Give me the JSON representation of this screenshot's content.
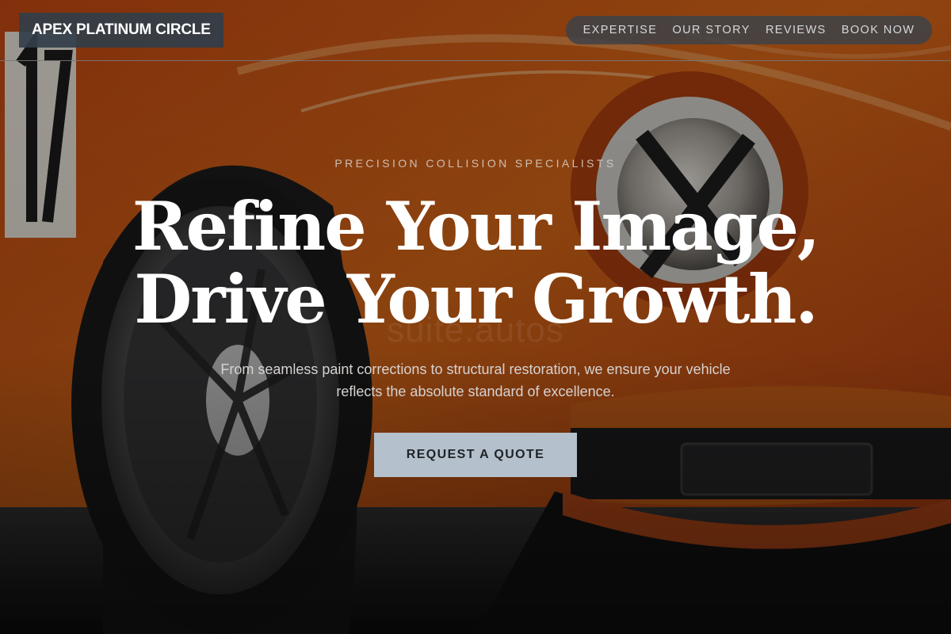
{
  "header": {
    "brand": "APEX PLATINUM CIRCLE",
    "nav": [
      "EXPERTISE",
      "OUR STORY",
      "REVIEWS",
      "BOOK NOW"
    ]
  },
  "hero": {
    "eyebrow": "PRECISION COLLISION SPECIALISTS",
    "headline_line1": "Refine Your Image,",
    "headline_line2": "Drive Your Growth.",
    "watermark": "suite.autos",
    "subtitle": "From seamless paint corrections to structural restoration, we ensure your vehicle reflects the absolute standard of excellence.",
    "cta_label": "REQUEST A QUOTE"
  },
  "colors": {
    "car_paint": "#d85a14",
    "cta_background": "#b4c0cb",
    "brand_background": "#323e4a",
    "nav_background": "#3a424a"
  },
  "background": {
    "subject": "orange classic car front wheel and headlight"
  }
}
